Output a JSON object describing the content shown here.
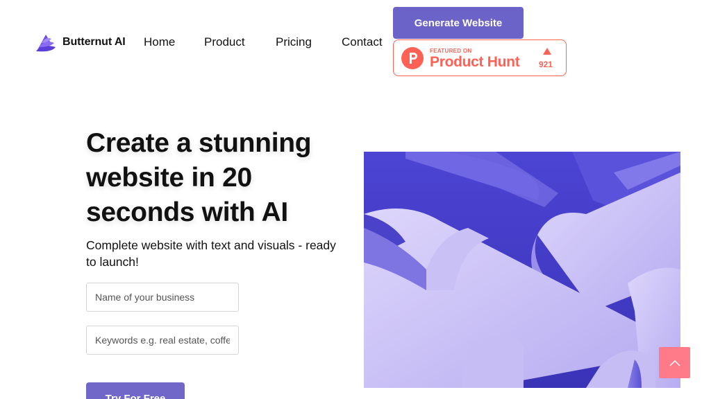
{
  "brand": {
    "name": "Butternut AI"
  },
  "nav": {
    "items": [
      "Home",
      "Product",
      "Pricing",
      "Contact"
    ]
  },
  "header": {
    "cta_label": "Generate Website"
  },
  "product_hunt": {
    "featured": "FEATURED ON",
    "name": "Product Hunt",
    "votes": "921"
  },
  "hero": {
    "title": "Create a stunning website in 20 seconds with AI",
    "subtitle": "Complete website with text and visuals - ready to launch!"
  },
  "form": {
    "business_placeholder": "Name of your business",
    "keywords_placeholder": "Keywords e.g. real estate, coffee",
    "submit_label": "Try For Free"
  },
  "colors": {
    "accent": "#6c63c8",
    "product_hunt": "#ff6154",
    "scroll_top": "#ff7b8a"
  }
}
